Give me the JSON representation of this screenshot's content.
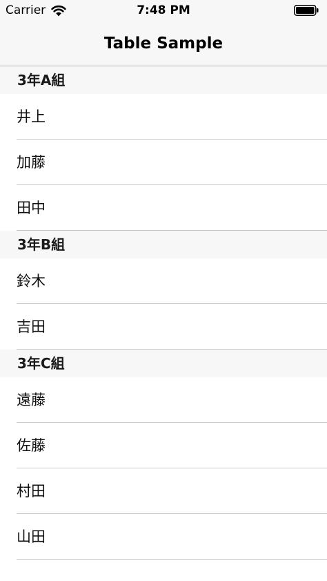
{
  "status_bar": {
    "carrier": "Carrier",
    "time": "7:48 PM",
    "wifi_icon": "wifi-icon",
    "battery_icon": "battery-icon",
    "battery_level": 1.0
  },
  "nav_bar": {
    "title": "Table Sample"
  },
  "sections": [
    {
      "header": "3年A組",
      "rows": [
        "井上",
        "加藤",
        "田中"
      ]
    },
    {
      "header": "3年B組",
      "rows": [
        "鈴木",
        "吉田"
      ]
    },
    {
      "header": "3年C組",
      "rows": [
        "遠藤",
        "佐藤",
        "村田",
        "山田"
      ]
    }
  ],
  "colors": {
    "bar_background": "#f7f7f7",
    "separator": "#c8c7cc",
    "text": "#000000"
  }
}
